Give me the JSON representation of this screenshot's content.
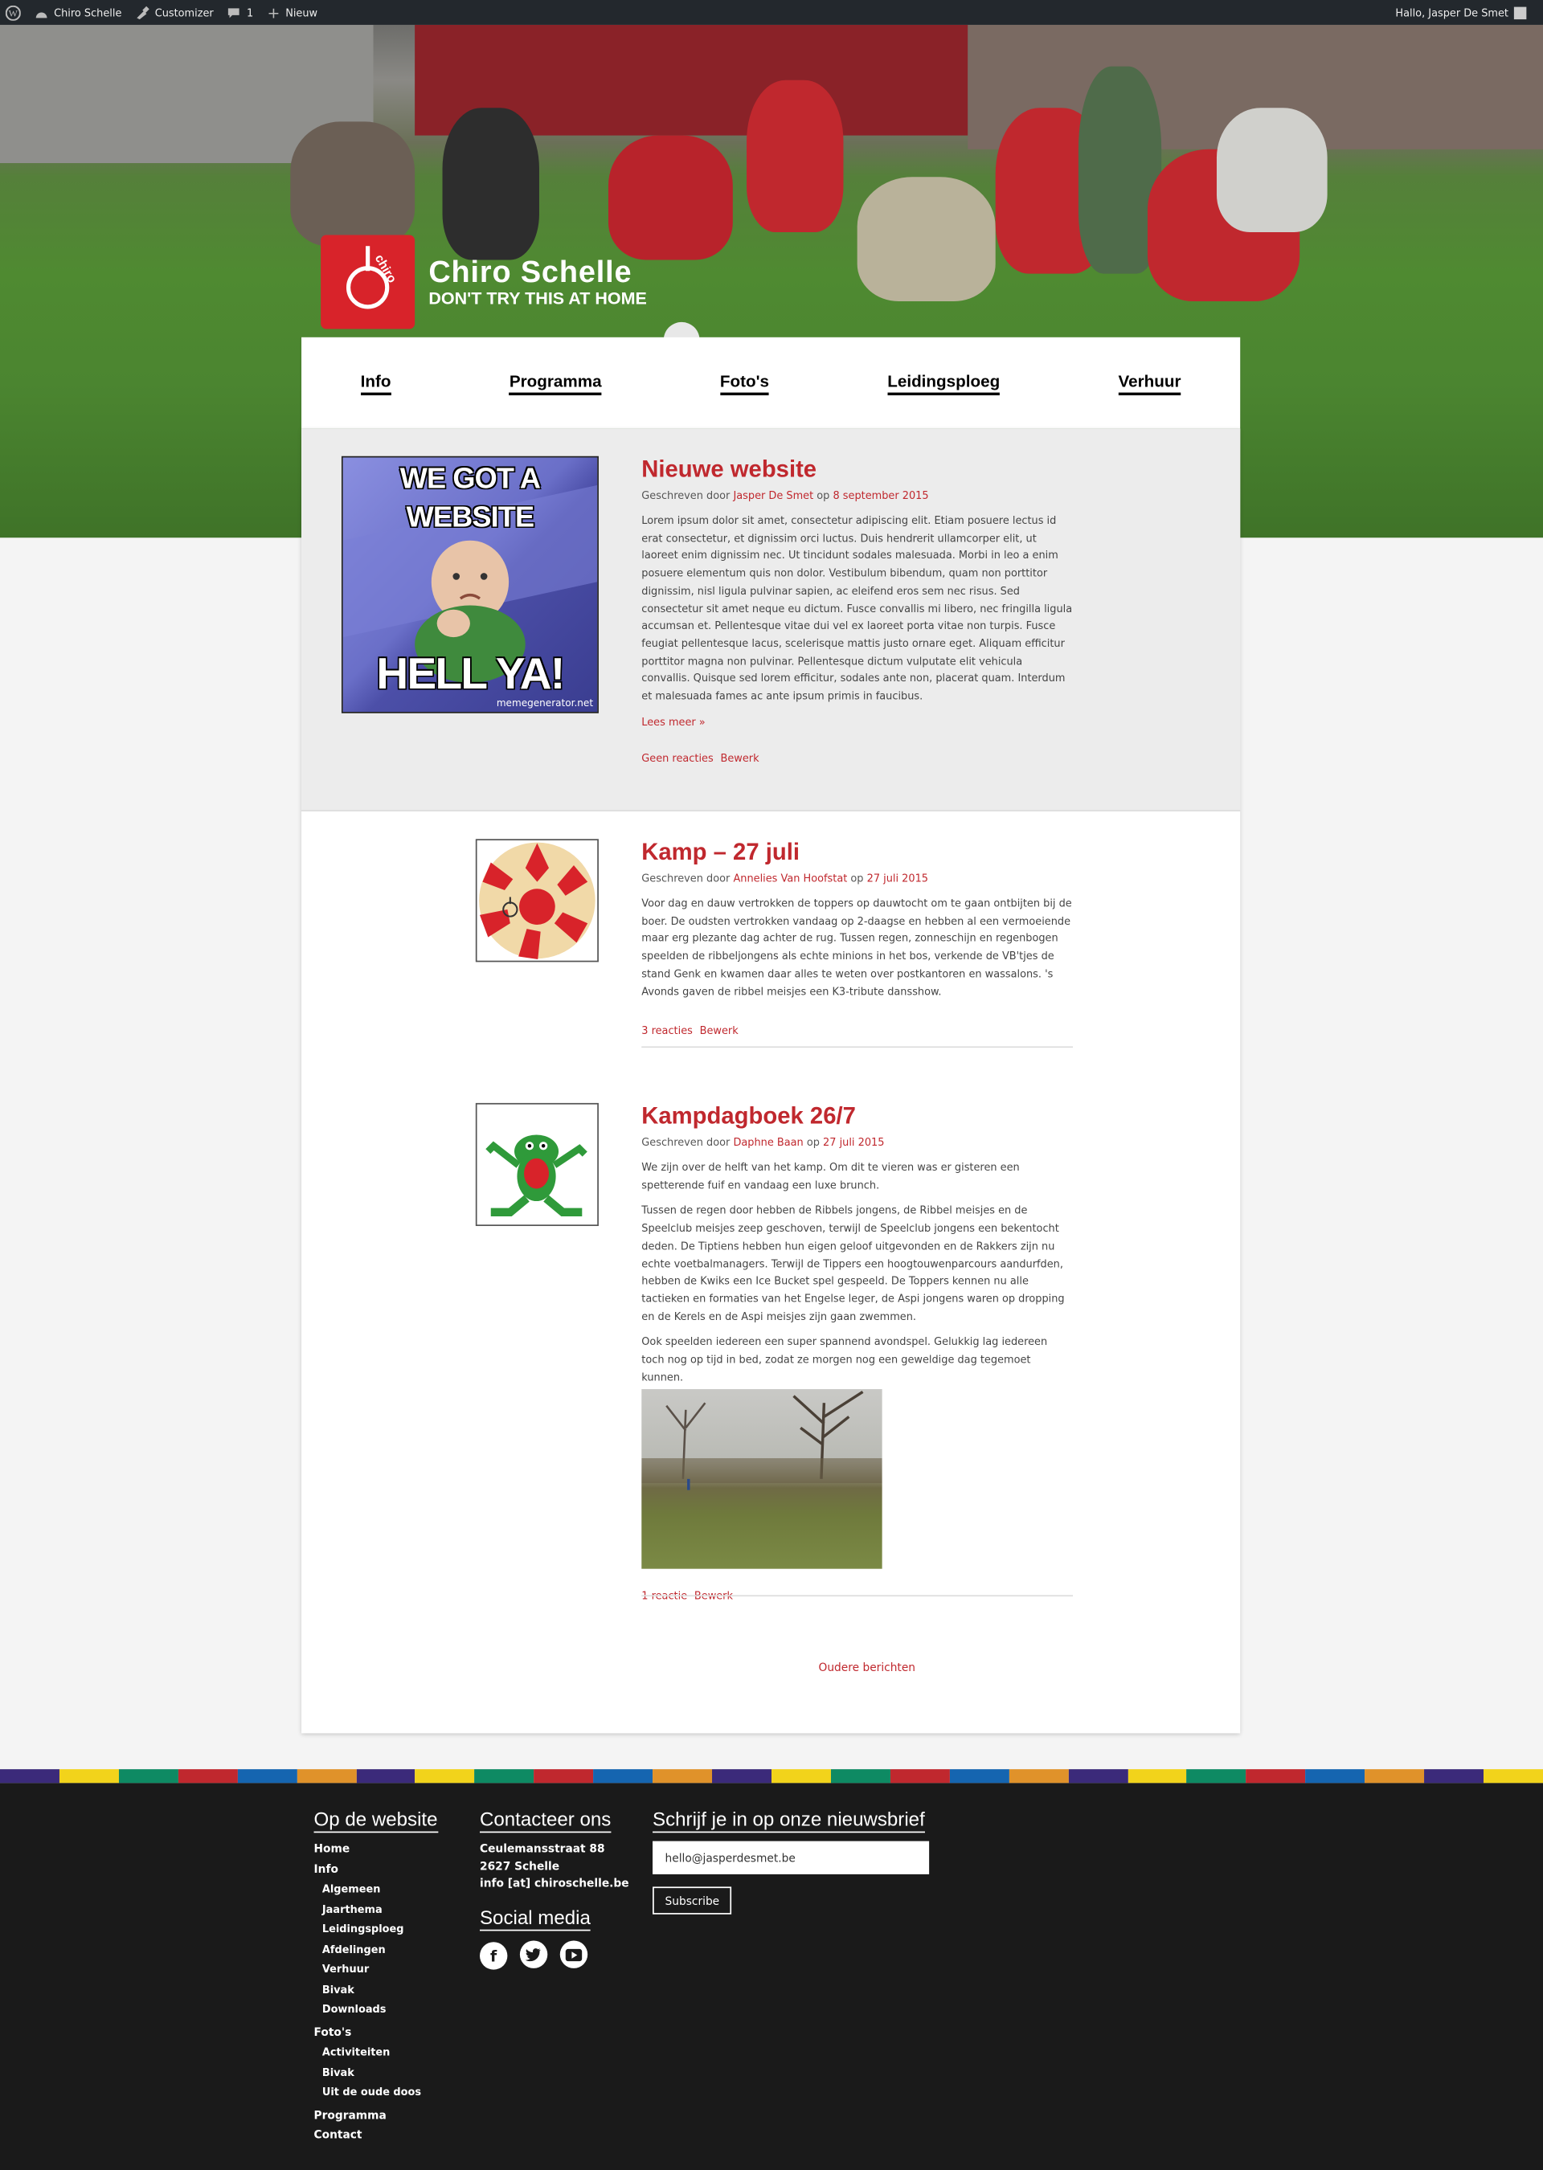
{
  "admin_bar": {
    "site": "Chiro Schelle",
    "customizer": "Customizer",
    "comments_count": "1",
    "new": "Nieuw",
    "greeting": "Hallo, Jasper De Smet"
  },
  "logo": {
    "title": "Chiro Schelle",
    "subtitle": "DON'T TRY THIS AT HOME",
    "mark_text": "chiro"
  },
  "nav": [
    "Info",
    "Programma",
    "Foto's",
    "Leidingsploeg",
    "Verhuur"
  ],
  "posts": [
    {
      "title": "Nieuwe website",
      "by": "Geschreven door",
      "author": "Jasper De Smet",
      "on": "op",
      "date": "8 september 2015",
      "body": "Lorem ipsum dolor sit amet, consectetur adipiscing elit. Etiam posuere lectus id erat consectetur, et dignissim orci luctus. Duis hendrerit ullamcorper elit, ut laoreet enim dignissim nec. Ut tincidunt sodales malesuada. Morbi in leo a enim posuere elementum quis non dolor. Vestibulum bibendum, quam non porttitor dignissim, nisl ligula pulvinar sapien, ac eleifend eros sem nec risus. Sed consectetur sit amet neque eu dictum. Fusce convallis mi libero, nec fringilla ligula accumsan et. Pellentesque vitae dui vel ex laoreet porta vitae non turpis. Fusce feugiat pellentesque lacus, scelerisque mattis justo ornare eget. Aliquam efficitur porttitor magna non pulvinar. Pellentesque dictum vulputate elit vehicula convallis. Quisque sed lorem efficitur, sodales ante non, placerat quam. Interdum et malesuada fames ac ante ipsum primis in faucibus.",
      "read_more": "Lees meer »",
      "comments": "Geen reacties",
      "edit": "Bewerk",
      "meme": {
        "top1": "WE GOT A",
        "top2": "WEBSITE",
        "bottom": "HELL YA!",
        "credit": "memegenerator.net"
      }
    },
    {
      "title": "Kamp – 27 juli",
      "by": "Geschreven door",
      "author": "Annelies Van Hoofstat",
      "on": "op",
      "date": "27 juli 2015",
      "body": "Voor dag en dauw vertrokken de toppers op dauwtocht om te gaan ontbijten bij de boer. De oudsten vertrokken vandaag op 2-daagse en hebben al een vermoeiende maar erg plezante dag achter de rug. Tussen regen, zonneschijn en regenbogen speelden de ribbeljongens als echte minions in het bos, verkende de VB'tjes de stand Genk en kwamen daar alles te weten over postkantoren en wassalons. 's Avonds gaven de ribbel meisjes een K3-tribute dansshow.",
      "comments": "3 reacties",
      "edit": "Bewerk"
    },
    {
      "title": "Kampdagboek 26/7",
      "by": "Geschreven door",
      "author": "Daphne Baan",
      "on": "op",
      "date": "27 juli 2015",
      "p1": "We zijn over de helft van het kamp. Om dit te vieren was er gisteren een spetterende fuif en vandaag een luxe brunch.",
      "p2": "Tussen de regen door hebben de Ribbels jongens, de Ribbel meisjes en de Speelclub meisjes zeep geschoven, terwijl de Speelclub jongens een bekentocht deden. De Tiptiens hebben hun eigen geloof uitgevonden en de Rakkers zijn nu echte voetbalmanagers. Terwijl de Tippers een hoogtouwenparcours aandurfden, hebben de Kwiks een Ice Bucket spel gespeeld. De Toppers kennen nu alle tactieken en formaties van het Engelse leger, de Aspi jongens waren op dropping en de Kerels en de Aspi meisjes zijn gaan zwemmen.",
      "p3": "Ook speelden iedereen een super spannend avondspel. Gelukkig lag iedereen toch nog op tijd in bed, zodat ze morgen nog een geweldige dag tegemoet kunnen.",
      "comments": "1 reactie",
      "edit": "Bewerk"
    }
  ],
  "older": "Oudere berichten",
  "stripe_colors": [
    "#3b2a7a",
    "#f2d31b",
    "#0e8a63",
    "#c0282e",
    "#1565b0",
    "#e0922a"
  ],
  "footer": {
    "col1_title": "Op de website",
    "home": "Home",
    "info": "Info",
    "info_sub": [
      "Algemeen",
      "Jaarthema",
      "Leidingsploeg",
      "Afdelingen",
      "Verhuur",
      "Bivak",
      "Downloads"
    ],
    "fotos": "Foto's",
    "fotos_sub": [
      "Activiteiten",
      "Bivak",
      "Uit de oude doos"
    ],
    "programma": "Programma",
    "contact": "Contact",
    "col2_title": "Contacteer ons",
    "address1": "Ceulemansstraat 88",
    "address2": "2627 Schelle",
    "email": "info [at] chiroschelle.be",
    "social_title": "Social media",
    "social": [
      "facebook-icon",
      "twitter-icon",
      "youtube-icon"
    ],
    "col3_title": "Schrijf je in op onze nieuwsbrief",
    "newsletter_value": "hello@jasperdesmet.be",
    "subscribe": "Subscribe"
  }
}
